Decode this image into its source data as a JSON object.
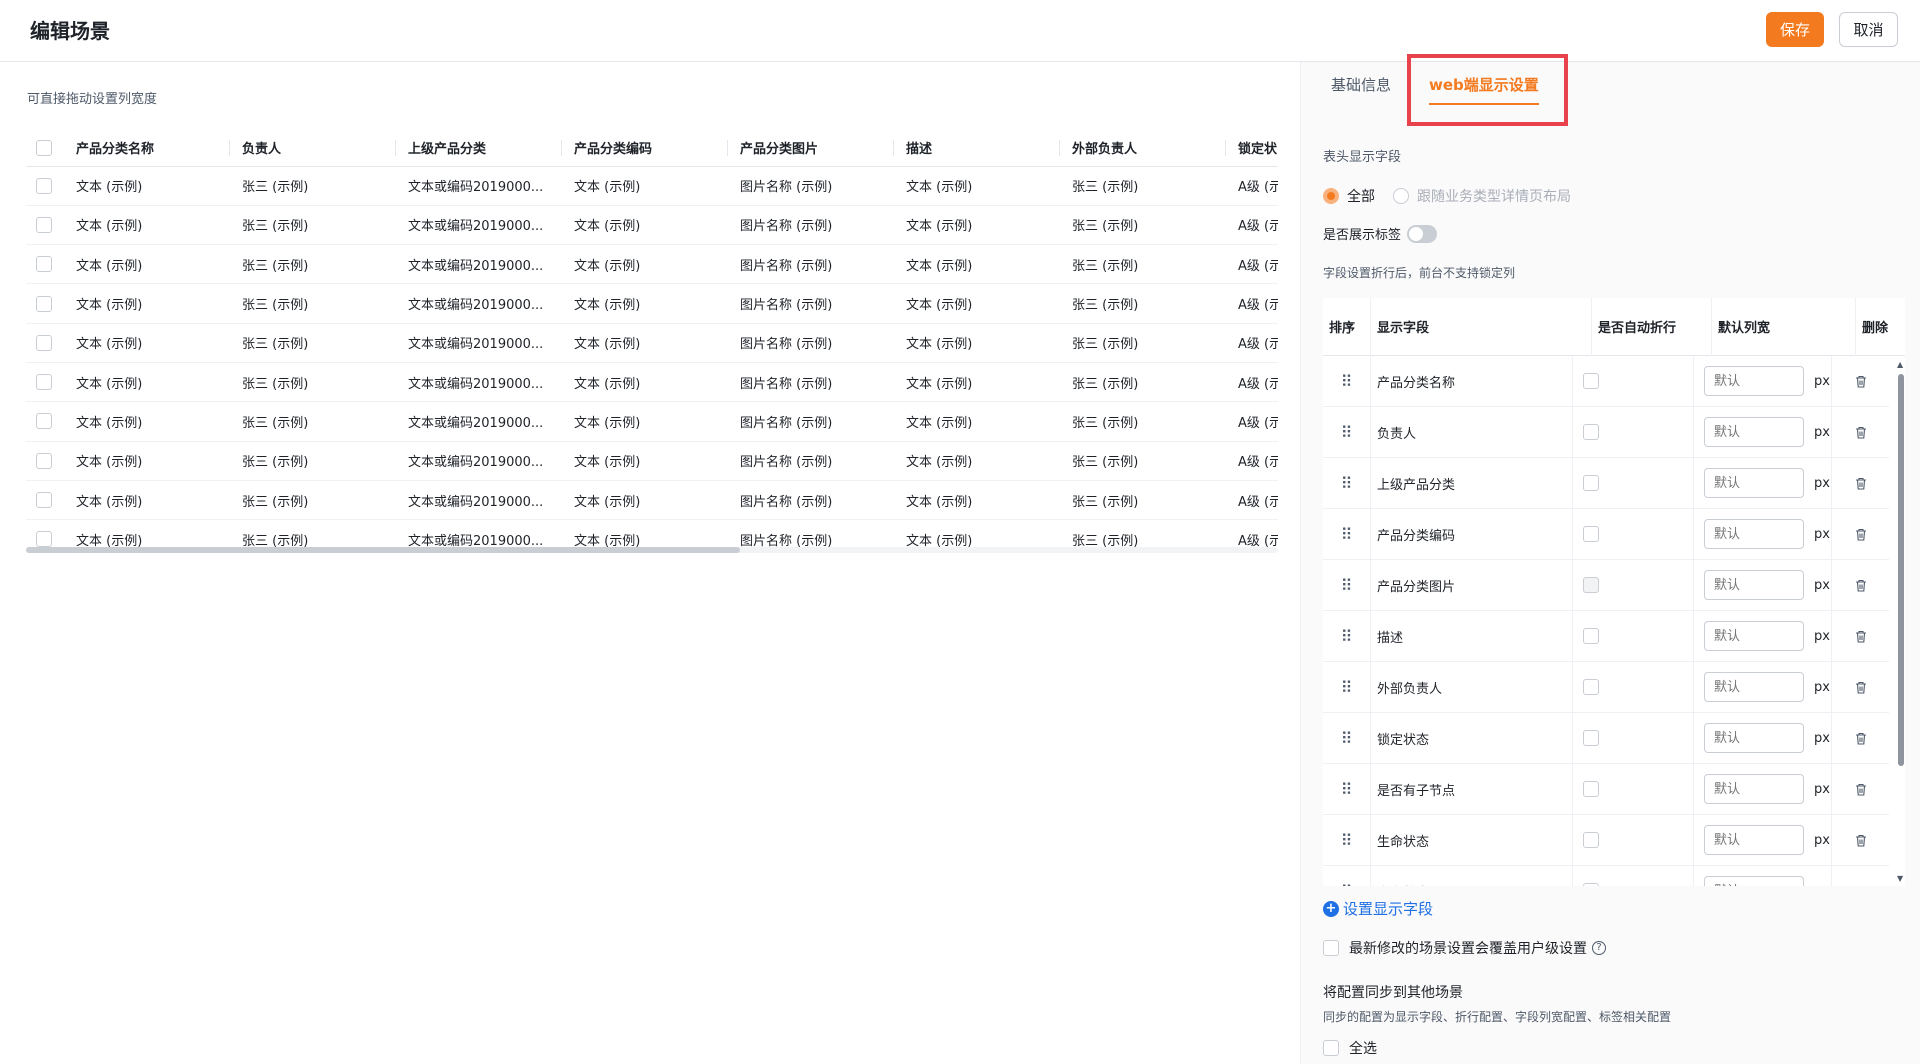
{
  "header": {
    "title": "编辑场景",
    "save_label": "保存",
    "cancel_label": "取消"
  },
  "preview": {
    "hint": "可直接拖动设置列宽度",
    "columns": [
      "产品分类名称",
      "负责人",
      "上级产品分类",
      "产品分类编码",
      "产品分类图片",
      "描述",
      "外部负责人",
      "锁定状"
    ],
    "row": [
      "文本 (示例)",
      "张三 (示例)",
      "文本或编码2019000...",
      "文本 (示例)",
      "图片名称 (示例)",
      "文本 (示例)",
      "张三 (示例)",
      "A级 (示"
    ],
    "row_count": 10
  },
  "panel": {
    "tabs": {
      "basic": "基础信息",
      "web": "web端显示设置"
    },
    "header_field_label": "表头显示字段",
    "radio_all": "全部",
    "radio_follow": "跟随业务类型详情页布局",
    "show_tag_label": "是否展示标签",
    "wrap_note": "字段设置折行后，前台不支持锁定列",
    "field_table": {
      "headers": {
        "sort": "排序",
        "field": "显示字段",
        "wrap": "是否自动折行",
        "width": "默认列宽",
        "delete": "删除"
      },
      "width_placeholder": "默认",
      "unit": "px",
      "rows": [
        "产品分类名称",
        "负责人",
        "上级产品分类",
        "产品分类编码",
        "产品分类图片",
        "描述",
        "外部负责人",
        "锁定状态",
        "是否有子节点",
        "生命状态",
        "生命状态"
      ]
    },
    "add_field_label": "设置显示字段",
    "override_label": "最新修改的场景设置会覆盖用户级设置",
    "sync_title": "将配置同步到其他场景",
    "sync_desc": "同步的配置为显示字段、折行配置、字段列宽配置、标签相关配置",
    "select_all_label": "全选"
  },
  "colors": {
    "accent": "#f37a1f",
    "link": "#1f6fe5",
    "highlight": "#e8424c"
  }
}
